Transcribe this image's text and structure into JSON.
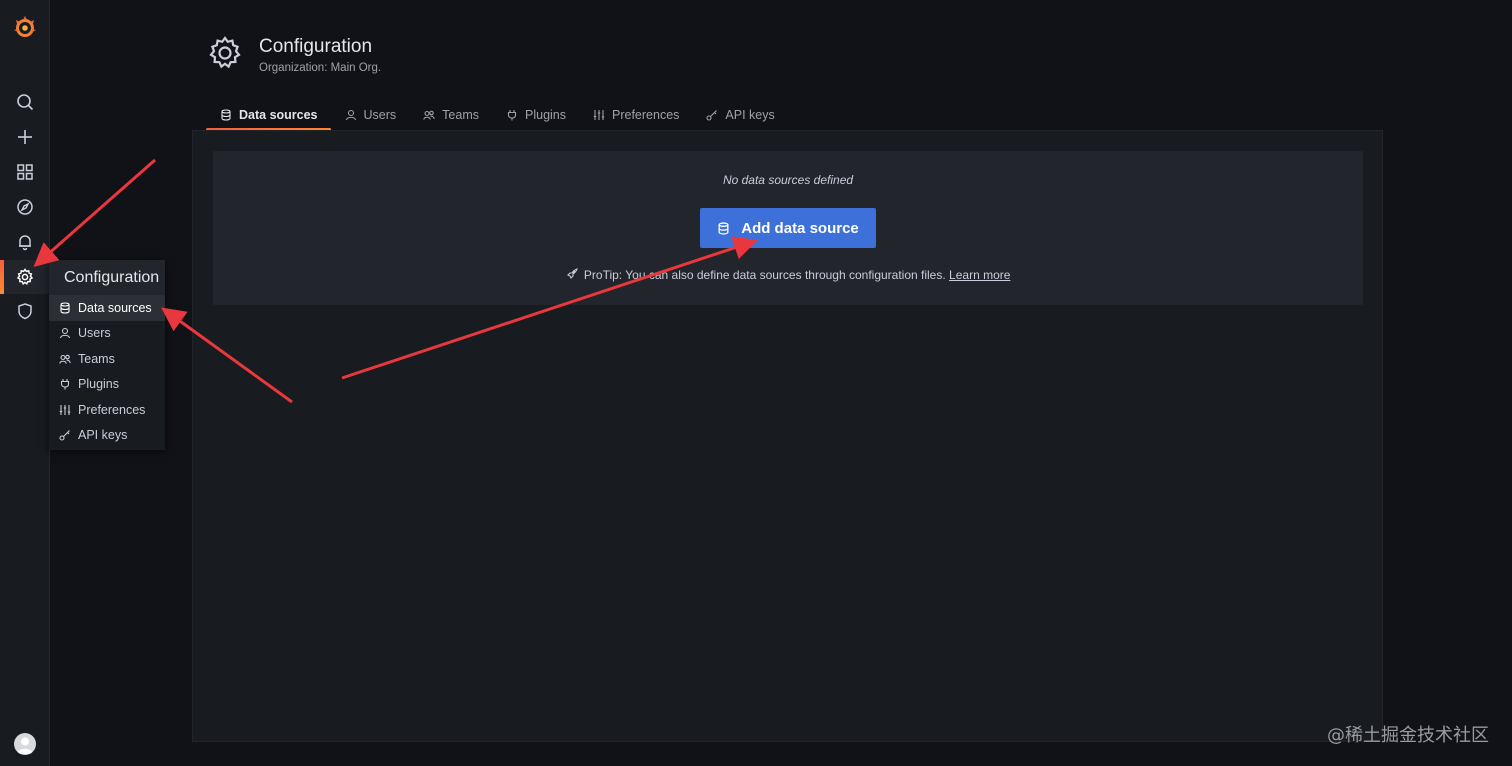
{
  "page": {
    "title": "Configuration",
    "subtitle": "Organization: Main Org."
  },
  "tabs": [
    {
      "label": "Data sources",
      "icon": "database-icon",
      "active": true
    },
    {
      "label": "Users",
      "icon": "user-icon",
      "active": false
    },
    {
      "label": "Teams",
      "icon": "users-icon",
      "active": false
    },
    {
      "label": "Plugins",
      "icon": "plug-icon",
      "active": false
    },
    {
      "label": "Preferences",
      "icon": "sliders-icon",
      "active": false
    },
    {
      "label": "API keys",
      "icon": "key-icon",
      "active": false
    }
  ],
  "sidebar": {
    "items": [
      {
        "icon": "search-icon"
      },
      {
        "icon": "plus-icon"
      },
      {
        "icon": "dashboards-icon"
      },
      {
        "icon": "compass-icon"
      },
      {
        "icon": "bell-icon"
      },
      {
        "icon": "gear-icon",
        "active": true
      },
      {
        "icon": "shield-icon"
      }
    ]
  },
  "flyout": {
    "title": "Configuration",
    "items": [
      {
        "label": "Data sources",
        "icon": "database-icon",
        "selected": true
      },
      {
        "label": "Users",
        "icon": "user-icon"
      },
      {
        "label": "Teams",
        "icon": "users-icon"
      },
      {
        "label": "Plugins",
        "icon": "plug-icon"
      },
      {
        "label": "Preferences",
        "icon": "sliders-icon"
      },
      {
        "label": "API keys",
        "icon": "key-icon"
      }
    ]
  },
  "empty_state": {
    "title": "No data sources defined",
    "button_label": "Add data source",
    "protip_text": "ProTip: You can also define data sources through configuration files.",
    "learn_more": "Learn more"
  },
  "watermark": "@稀土掘金技术社区",
  "colors": {
    "accent_orange": "#f55f3e",
    "primary_button": "#3d71d9",
    "annotation_arrow": "#e8383d"
  }
}
